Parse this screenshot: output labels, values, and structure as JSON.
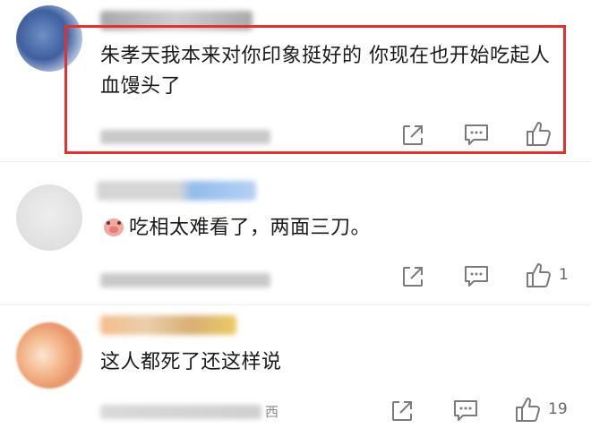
{
  "comments": [
    {
      "text": "朱孝天我本来对你印象挺好的 你现在也开始吃起人血馒头了",
      "like_count": "",
      "highlighted": true
    },
    {
      "text": "吃相太难看了，两面三刀。",
      "emoji": "pig-face-icon",
      "like_count": "1"
    },
    {
      "text": "这人都死了还这样说",
      "meta_suffix": "西",
      "like_count": "19"
    }
  ],
  "colors": {
    "highlight_border": "#e0322f",
    "icon_gray": "#7a7a7a"
  }
}
